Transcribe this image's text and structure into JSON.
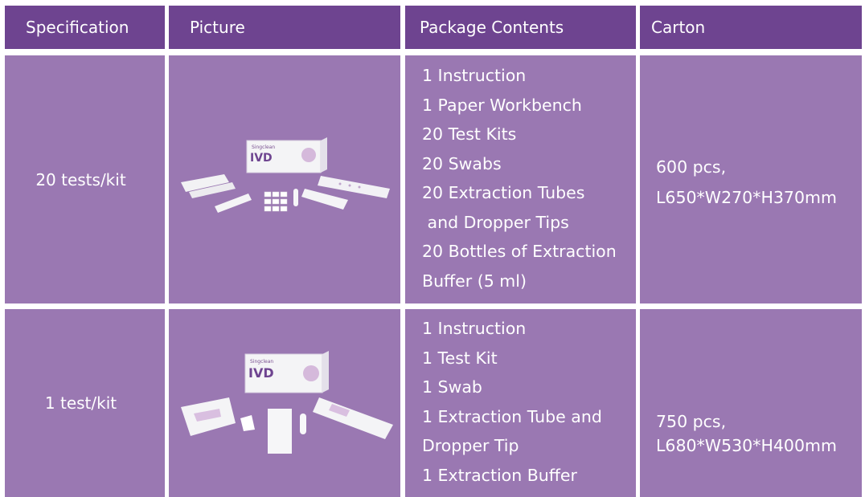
{
  "header": {
    "specification": "Specification",
    "picture": "Picture",
    "package_contents": "Package Contents",
    "carton": "Carton"
  },
  "rows": [
    {
      "specification": "20 tests/kit",
      "picture_brand": "Singclean",
      "picture_logo": "IVD",
      "contents": [
        "1 Instruction",
        "1 Paper Workbench",
        "20 Test Kits",
        "20 Swabs",
        "20 Extraction Tubes",
        " and Dropper Tips",
        "20 Bottles of Extraction",
        "Buffer (5 ml)"
      ],
      "carton_qty": "600 pcs,",
      "carton_size": "L650*W270*H370mm"
    },
    {
      "specification": "1 test/kit",
      "picture_brand": "Singclean",
      "picture_logo": "IVD",
      "contents": [
        "1 Instruction",
        "1 Test Kit",
        "1 Swab",
        "1 Extraction Tube and",
        "Dropper Tip",
        "1 Extraction Buffer"
      ],
      "carton_qty": "750 pcs,",
      "carton_size": "L680*W530*H400mm"
    }
  ],
  "colors": {
    "header_bg": "#6e4490",
    "cell_bg": "#9a78b2",
    "text": "#ffffff"
  }
}
